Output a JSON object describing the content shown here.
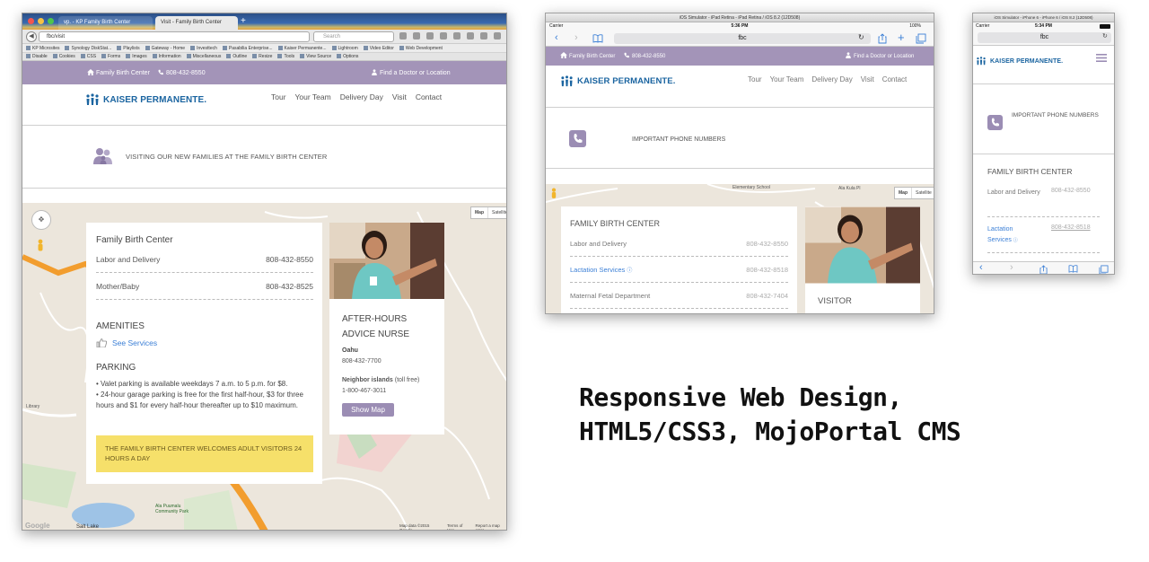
{
  "desktop": {
    "tabs": [
      {
        "label": "vp. - KP Family Birth Center"
      },
      {
        "label": "Visit - Family Birth Center"
      }
    ],
    "url": "fbc/visit",
    "search_placeholder": "Search",
    "bookmarks_row1": [
      "KP Microsites",
      "Synology DiskStat...",
      "Playlists",
      "Gateway - Home",
      "Investtech",
      "Pasabilia Enterprise...",
      "Kaiser Permanente...",
      "Lightroom",
      "Video Editor",
      "Web Development"
    ],
    "bookmarks_row2": [
      "Disable",
      "Cookies",
      "CSS",
      "Forms",
      "Images",
      "Information",
      "Miscellaneous",
      "Outline",
      "Resize",
      "Tools",
      "View Source",
      "Options"
    ],
    "util": {
      "home": "Family Birth Center",
      "phone": "808-432-8550",
      "find": "Find a Doctor or Location"
    },
    "logo": "KAISER PERMANENTE.",
    "nav": [
      "Tour",
      "Your Team",
      "Delivery Day",
      "Visit",
      "Contact"
    ],
    "banner": "VISITING OUR NEW FAMILIES AT THE FAMILY BIRTH CENTER",
    "info_card": {
      "title": "Family Birth Center",
      "rows": [
        {
          "label": "Labor and Delivery",
          "value": "808-432-8550"
        },
        {
          "label": "Mother/Baby",
          "value": "808-432-8525"
        }
      ],
      "amenities_title": "AMENITIES",
      "see_services": "See Services",
      "parking_title": "PARKING",
      "parking_items": [
        "Valet parking is available weekdays 7 a.m. to 5 p.m. for $8.",
        "24-hour garage parking is free for the first half-hour, $3 for three hours and $1 for every half-hour thereafter up to $10 maximum."
      ],
      "notice": "THE FAMILY BIRTH CENTER WELCOMES ADULT VISITORS 24 HOURS A DAY"
    },
    "advice_card": {
      "title": "AFTER-HOURS ADVICE NURSE",
      "oahu_label": "Oahu",
      "oahu_phone": "808-432-7700",
      "neighbor_label": "Neighbor islands",
      "neighbor_note": "(toll free)",
      "neighbor_phone": "1-800-467-3011",
      "button": "Show Map"
    },
    "map": {
      "type_map": "Map",
      "type_satellite": "Satellite",
      "labels": [
        "Salt Lake",
        "Ala Puumalu Community Park",
        "Aliamanu Dr",
        "Hibiscus Dr",
        "Library",
        "Army Medical Center"
      ],
      "footer": [
        "Map data ©2015 Google",
        "Terms of Use",
        "Report a map error"
      ],
      "google": "Google"
    }
  },
  "ipad": {
    "title": "iOS Simulator - iPad Retina - iPad Retina / iOS 8.2 (12D508)",
    "carrier": "Carrier",
    "time": "5:36 PM",
    "battery": "100%",
    "url": "fbc",
    "util": {
      "home": "Family Birth Center",
      "phone": "808-432-8550",
      "find": "Find a Doctor or Location"
    },
    "logo": "KAISER PERMANENTE.",
    "nav": [
      "Tour",
      "Your Team",
      "Delivery Day",
      "Visit",
      "Contact"
    ],
    "banner": "IMPORTANT PHONE NUMBERS",
    "card_title": "FAMILY BIRTH CENTER",
    "rows": [
      {
        "label": "Labor and Delivery",
        "value": "808-432-8550"
      },
      {
        "label": "Lactation Services",
        "value": "808-432-8518"
      },
      {
        "label": "Maternal Fetal Department",
        "value": "808-432-7404"
      }
    ],
    "visitor": "VISITOR",
    "map_labels": [
      "Ala Kula Pl",
      "Elementary School"
    ],
    "type_map": "Map",
    "type_satellite": "Satellite"
  },
  "iphone": {
    "title": "iOS Simulator - iPhone 6 - iPhone 6 / iOS 8.2 (12D508)",
    "carrier": "Carrier",
    "time": "5:34 PM",
    "url": "fbc",
    "logo": "KAISER PERMANENTE.",
    "banner": "IMPORTANT PHONE NUMBERS",
    "card_title": "FAMILY BIRTH CENTER",
    "rows": [
      {
        "label": "Labor and Delivery",
        "value": "808-432-8550"
      },
      {
        "label": "Lactation Services",
        "value": "808-432-8518"
      }
    ]
  },
  "caption": {
    "line1": "Responsive Web Design,",
    "line2": "HTML5/CSS3, MojoPortal CMS"
  },
  "colors": {
    "brand_purple": "#a394b8",
    "kp_blue": "#1a64a0",
    "link_blue": "#3b7fd6",
    "notice_yellow": "#f6e06a",
    "button_purple": "#9b8db4"
  }
}
